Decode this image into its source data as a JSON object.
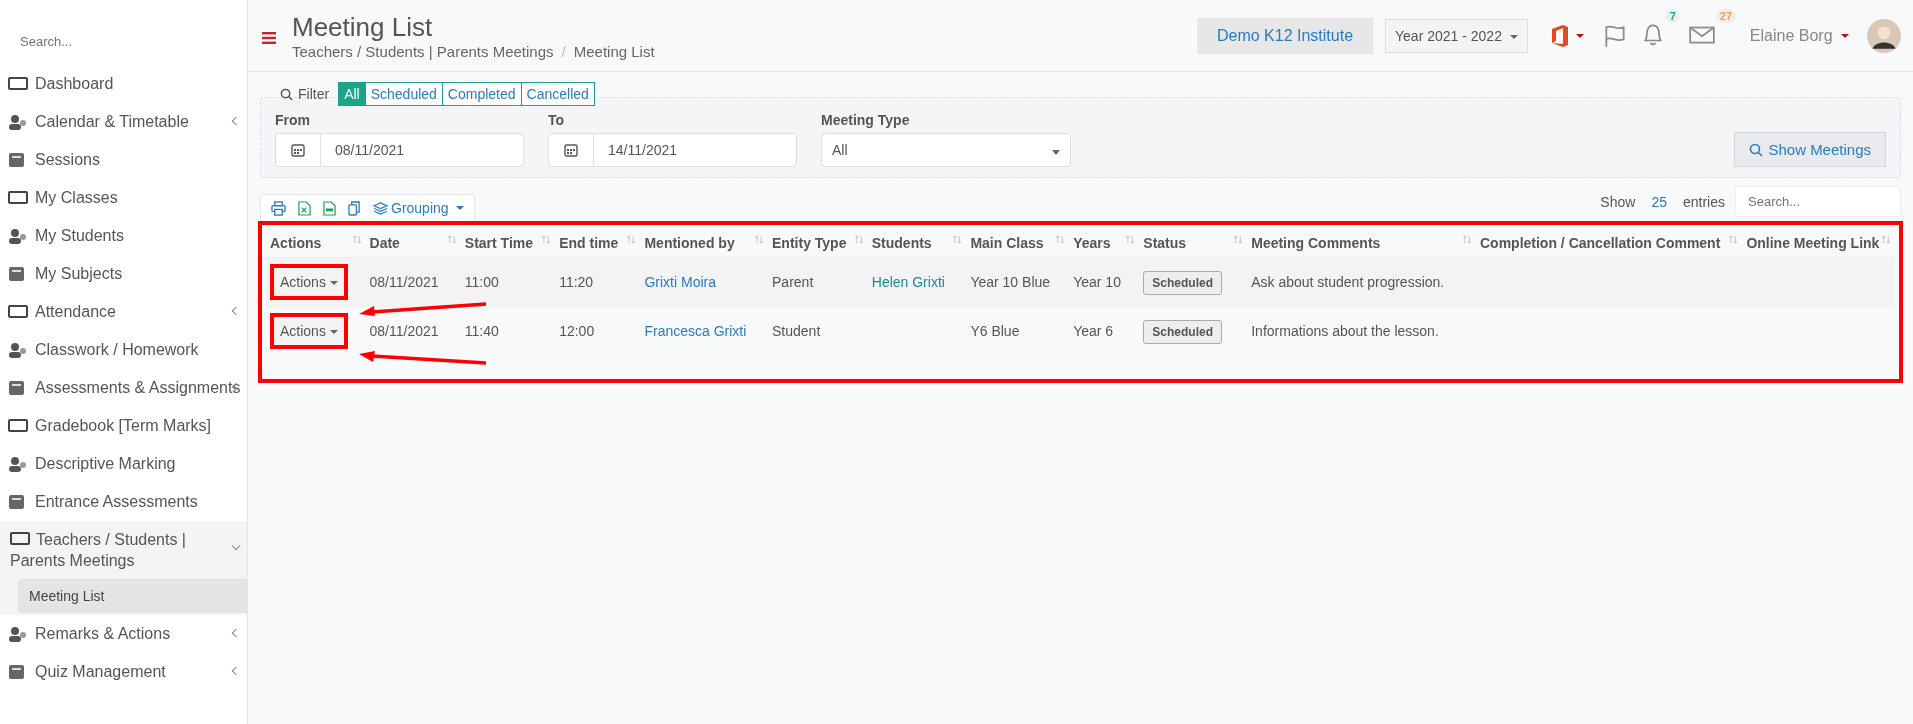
{
  "sidebar": {
    "search": {
      "placeholder": "Search..."
    },
    "items": [
      {
        "label": "Dashboard",
        "expandable": false,
        "expanded": false,
        "selected": false
      },
      {
        "label": "Calendar & Timetable",
        "expandable": true,
        "expanded": false,
        "selected": false
      },
      {
        "label": "Sessions",
        "expandable": false,
        "expanded": false,
        "selected": false
      },
      {
        "label": "My Classes",
        "expandable": false,
        "expanded": false,
        "selected": false
      },
      {
        "label": "My Students",
        "expandable": false,
        "expanded": false,
        "selected": false
      },
      {
        "label": "My Subjects",
        "expandable": false,
        "expanded": false,
        "selected": false
      },
      {
        "label": "Attendance",
        "expandable": true,
        "expanded": false,
        "selected": false
      },
      {
        "label": "Classwork / Homework",
        "expandable": false,
        "expanded": false,
        "selected": false
      },
      {
        "label": "Assessments & Assignments",
        "expandable": true,
        "expanded": false,
        "selected": false
      },
      {
        "label": "Gradebook [Term Marks]",
        "expandable": false,
        "expanded": false,
        "selected": false
      },
      {
        "label": "Descriptive Marking",
        "expandable": false,
        "expanded": false,
        "selected": false
      },
      {
        "label": "Entrance Assessments",
        "expandable": false,
        "expanded": false,
        "selected": false
      },
      {
        "label": "Teachers / Students | Parents Meetings",
        "expandable": true,
        "expanded": true,
        "selected": false,
        "children": [
          {
            "label": "Meeting List",
            "selected": true
          }
        ]
      },
      {
        "label": "Remarks & Actions",
        "expandable": true,
        "expanded": false,
        "selected": false
      },
      {
        "label": "Quiz Management",
        "expandable": true,
        "expanded": false,
        "selected": false
      }
    ]
  },
  "header": {
    "title": "Meeting List",
    "breadcrumb": [
      "Teachers / Students | Parents Meetings",
      "Meeting List"
    ],
    "breadcrumb_separator": "/",
    "institute": "Demo K12 Institute",
    "year": "Year 2021 - 2022",
    "notifications": "7",
    "messages": "27",
    "user": "Elaine Borg"
  },
  "filter": {
    "label": "Filter",
    "tabs": [
      {
        "label": "All",
        "selected": true
      },
      {
        "label": "Scheduled",
        "selected": false
      },
      {
        "label": "Completed",
        "selected": false
      },
      {
        "label": "Cancelled",
        "selected": false
      }
    ],
    "from": {
      "label": "From",
      "value": "08/11/2021"
    },
    "to": {
      "label": "To",
      "value": "14/11/2021"
    },
    "meeting_type": {
      "label": "Meeting Type",
      "value": "All"
    },
    "button": "Show Meetings"
  },
  "toolbar": {
    "grouping": "Grouping",
    "show": "Show",
    "page_size": "25",
    "entries": "entries",
    "search": {
      "placeholder": "Search..."
    }
  },
  "table": {
    "highlighted": true,
    "columns": [
      "Actions",
      "Date",
      "Start Time",
      "End time",
      "Mentioned by",
      "Entity Type",
      "Students",
      "Main Class",
      "Years",
      "Status",
      "Meeting Comments",
      "Completion / Cancellation Comment",
      "Online Meeting Link"
    ],
    "rows": [
      {
        "action": "Actions",
        "action_marked": true,
        "date": "08/11/2021",
        "start_time": "11:00",
        "end_time": "11:20",
        "mentioned_by": "Grixti Moira",
        "entity_type": "Parent",
        "students": "Helen Grixti",
        "main_class": "Year 10 Blue",
        "years": "Year 10",
        "status": "Scheduled",
        "meeting_comments": "Ask about student progression."
      },
      {
        "action": "Actions",
        "action_marked": true,
        "date": "08/11/2021",
        "start_time": "11:40",
        "end_time": "12:00",
        "mentioned_by": "Francesca Grixti",
        "entity_type": "Student",
        "main_class": "Y6 Blue",
        "years": "Year 6",
        "status": "Scheduled",
        "meeting_comments": "Informations about the lesson."
      }
    ]
  }
}
